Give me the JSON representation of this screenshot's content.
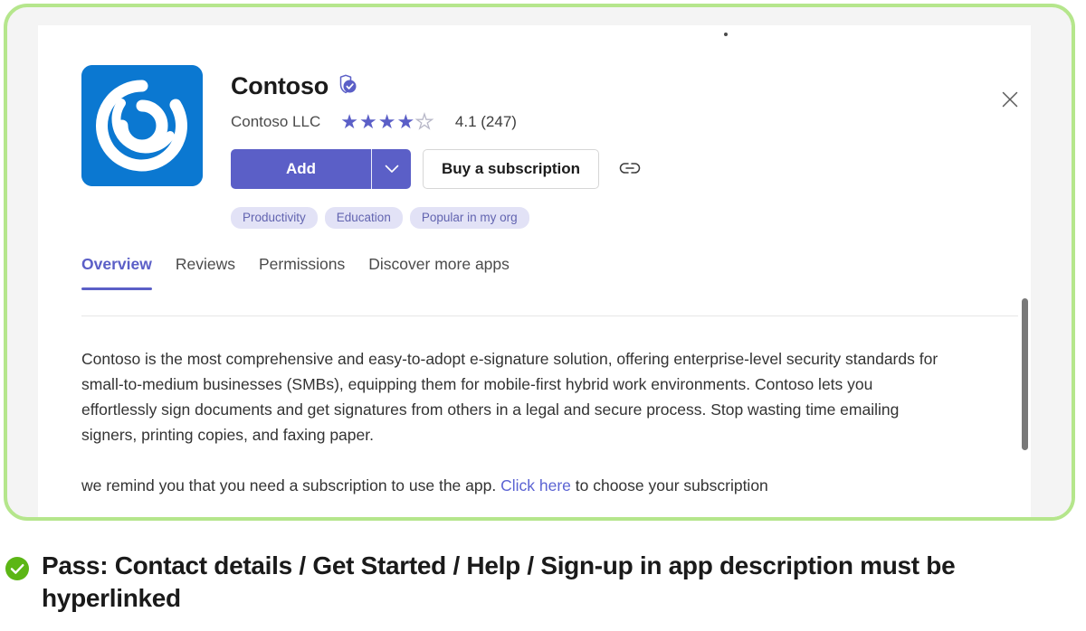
{
  "colors": {
    "accent_purple": "#5b5fc7",
    "icon_blue": "#0b78d1",
    "annotation_green": "#b5e68c",
    "check_green": "#5cb615",
    "tag_bg": "#e2e2f6",
    "tag_text": "#6264b0",
    "link_blue": "#5b63d3"
  },
  "app": {
    "name": "Contoso",
    "verified_icon": "verified-shield-icon",
    "icon_name": "contoso-app-icon",
    "publisher": "Contoso LLC",
    "rating_value": "4.1",
    "rating_count": "(247)",
    "rating_text": "4.1 (247)",
    "stars_filled": 4,
    "stars_total": 5
  },
  "actions": {
    "add_label": "Add",
    "dropdown_icon": "chevron-down-icon",
    "buy_label": "Buy a subscription",
    "link_icon": "link-icon",
    "close_icon": "close-icon"
  },
  "tags": [
    {
      "label": "Productivity"
    },
    {
      "label": "Education"
    },
    {
      "label": "Popular in my org"
    }
  ],
  "tabs": [
    {
      "label": "Overview",
      "active": true
    },
    {
      "label": "Reviews",
      "active": false
    },
    {
      "label": "Permissions",
      "active": false
    },
    {
      "label": "Discover more apps",
      "active": false
    }
  ],
  "overview": {
    "paragraph_1": "Contoso is the most comprehensive and easy-to-adopt e-signature solution, offering enterprise-level security standards for small-to-medium businesses (SMBs), equipping them for mobile-first hybrid work environments. Contoso lets you effortlessly sign documents and get signatures from others in a legal and secure process. Stop wasting time emailing signers, printing copies, and faxing paper.",
    "paragraph_2_before": "we remind you that  you need a subscription to use the app. ",
    "paragraph_2_link": "Click here",
    "paragraph_2_after": " to choose your subscription"
  },
  "annotation": {
    "status_icon": "check-circle-icon",
    "text": "Pass: Contact details / Get Started / Help / Sign-up in app description must be hyperlinked"
  }
}
